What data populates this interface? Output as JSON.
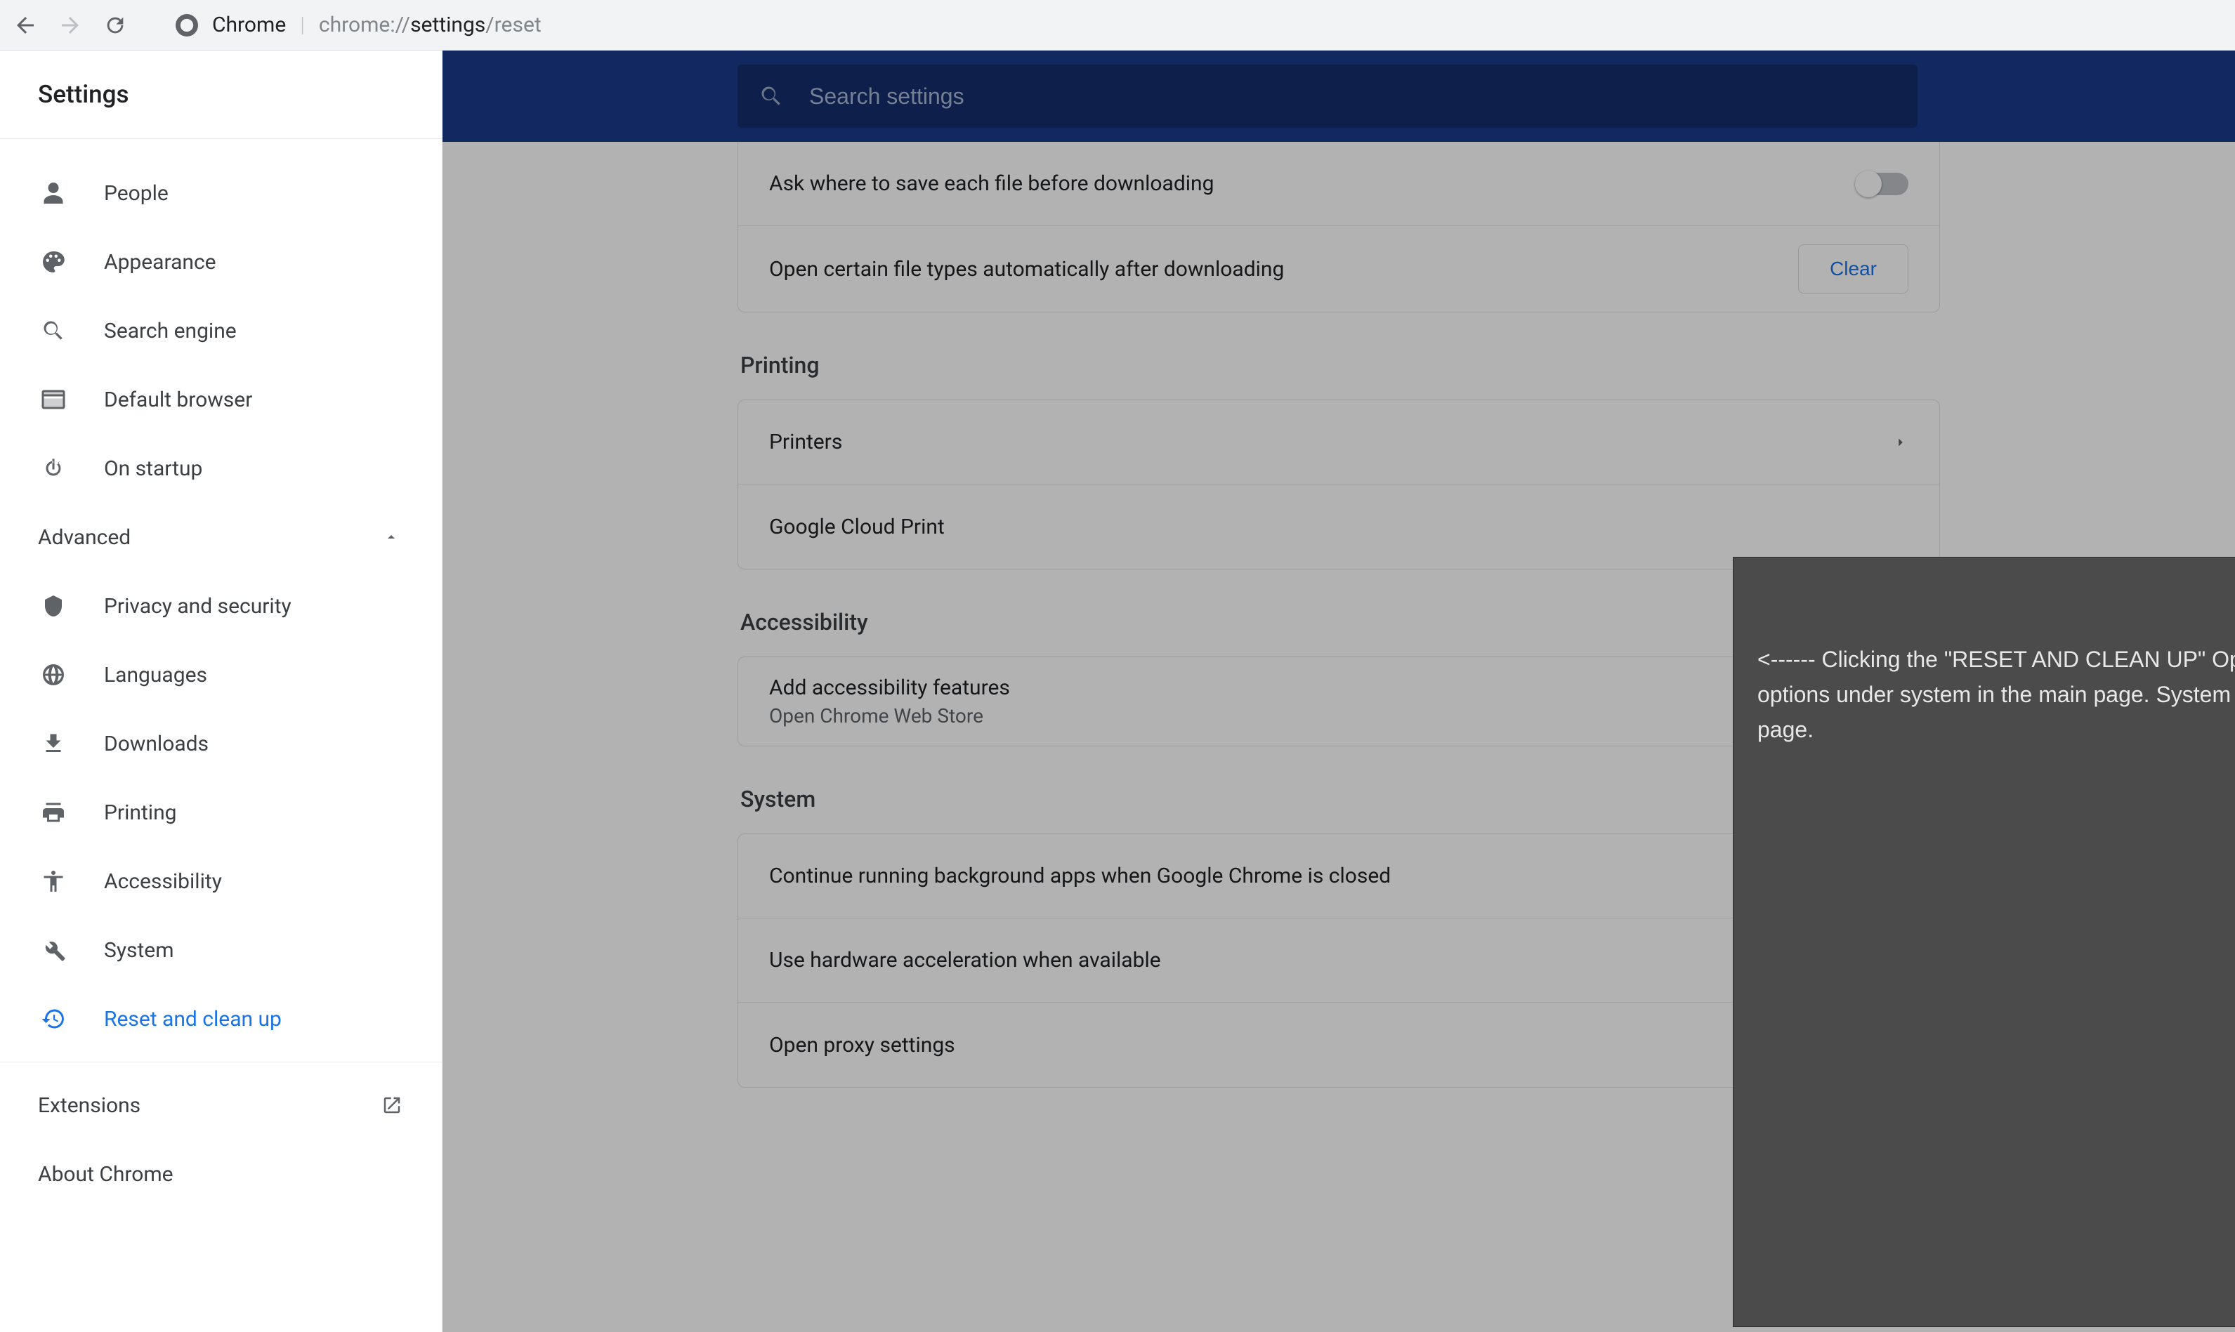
{
  "browser": {
    "site_label": "Chrome",
    "url_prefix": "chrome://",
    "url_path_dark": "settings",
    "url_path_rest": "/reset"
  },
  "sidebar": {
    "title": "Settings",
    "basic": [
      {
        "icon": "person",
        "label": "People"
      },
      {
        "icon": "palette",
        "label": "Appearance"
      },
      {
        "icon": "search",
        "label": "Search engine"
      },
      {
        "icon": "browser",
        "label": "Default browser"
      },
      {
        "icon": "power",
        "label": "On startup"
      }
    ],
    "advanced_label": "Advanced",
    "advanced": [
      {
        "icon": "shield",
        "label": "Privacy and security"
      },
      {
        "icon": "globe",
        "label": "Languages"
      },
      {
        "icon": "download",
        "label": "Downloads"
      },
      {
        "icon": "print",
        "label": "Printing"
      },
      {
        "icon": "accessibility",
        "label": "Accessibility"
      },
      {
        "icon": "wrench",
        "label": "System"
      },
      {
        "icon": "history",
        "label": "Reset and clean up",
        "active": true
      }
    ],
    "footer": [
      {
        "label": "Extensions",
        "external": true
      },
      {
        "label": "About Chrome",
        "external": false
      }
    ]
  },
  "search": {
    "placeholder": "Search settings"
  },
  "sections": {
    "downloads_rows": {
      "ask": "Ask where to save each file before downloading",
      "auto_open": "Open certain file types automatically after downloading",
      "clear_btn": "Clear"
    },
    "printing": {
      "heading": "Printing",
      "printers": "Printers",
      "gcp": "Google Cloud Print"
    },
    "accessibility": {
      "heading": "Accessibility",
      "add": "Add accessibility features",
      "add_sub": "Open Chrome Web Store"
    },
    "system": {
      "heading": "System",
      "bg": "Continue running background apps when Google Chrome is closed",
      "hw": "Use hardware acceleration when available",
      "proxy": "Open proxy settings"
    }
  },
  "annotation": {
    "text": "<------ Clicking the \"RESET AND CLEAN UP\" Option does not show any options under system in the main page. System is the last item on this page."
  }
}
